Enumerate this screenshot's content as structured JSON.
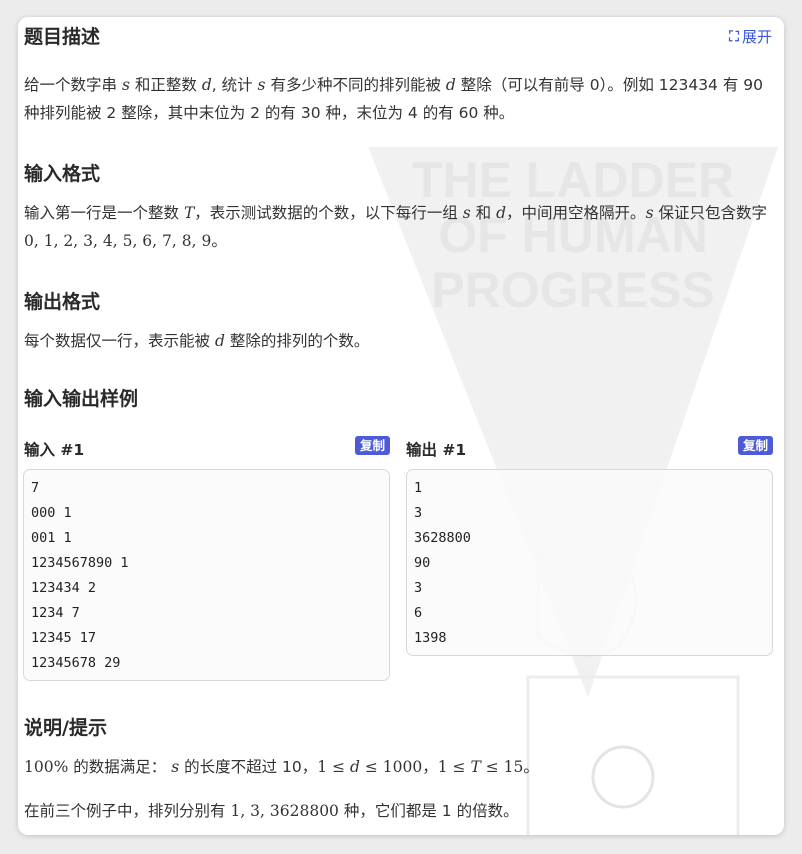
{
  "header": {
    "title": "题目描述",
    "expand_label": "展开",
    "expand_icon": "fullscreen-icon"
  },
  "description": {
    "p1": "给一个数字串",
    "v_s": "s",
    "p2": "和正整数",
    "v_d": "d",
    "p3": ", 统计",
    "v_s2": "s",
    "p4": "有多少种不同的排列能被",
    "v_d2": "d",
    "p5": "整除（可以有前导 0）。例如 123434 有 90 种排列能被 2 整除，其中末位为 2 的有 30 种，末位为 4 的有 60 种。"
  },
  "input_format": {
    "title": "输入格式",
    "p1": "输入第一行是一个整数",
    "v_T": "T",
    "p2": "，表示测试数据的个数，以下每行一组",
    "v_s": "s",
    "p3": "和",
    "v_d": "d",
    "p4": "，中间用空格隔开。",
    "v_s2": "s",
    "p5": "保证只包含数字",
    "digits": "0, 1, 2, 3, 4, 5, 6, 7, 8, 9",
    "p6": "。"
  },
  "output_format": {
    "title": "输出格式",
    "p1": "每个数据仅一行，表示能被",
    "v_d": "d",
    "p2": "整除的排列的个数。"
  },
  "samples": {
    "title": "输入输出样例",
    "input_label": "输入 #1",
    "output_label": "输出 #1",
    "copy_label": "复制",
    "input_lines": [
      "7",
      "000 1",
      "001 1",
      "1234567890 1",
      "123434 2",
      "1234 7",
      "12345 17",
      "12345678 29"
    ],
    "output_lines": [
      "1",
      "3",
      "3628800",
      "90",
      "3",
      "6",
      "1398"
    ]
  },
  "hint": {
    "title": "说明/提示",
    "l1_pct": "100%",
    "l1_a": "的数据满足：",
    "l1_s": "s",
    "l1_b": "的长度不超过 10，",
    "l1_c1": "1 ≤ ",
    "l1_d": "d",
    "l1_c2": " ≤ 1000",
    "l1_sep": "，",
    "l1_e1": "1 ≤ ",
    "l1_T": "T",
    "l1_e2": " ≤ 15",
    "l1_end": "。",
    "l2_a": "在前三个例子中，排列分别有",
    "l2_vals": "1, 3, 3628800",
    "l2_b": "种，它们都是 1 的倍数。"
  },
  "watermark": {
    "lines": [
      "THE LADDER",
      "OF HUMAN",
      "PROGRESS"
    ]
  }
}
